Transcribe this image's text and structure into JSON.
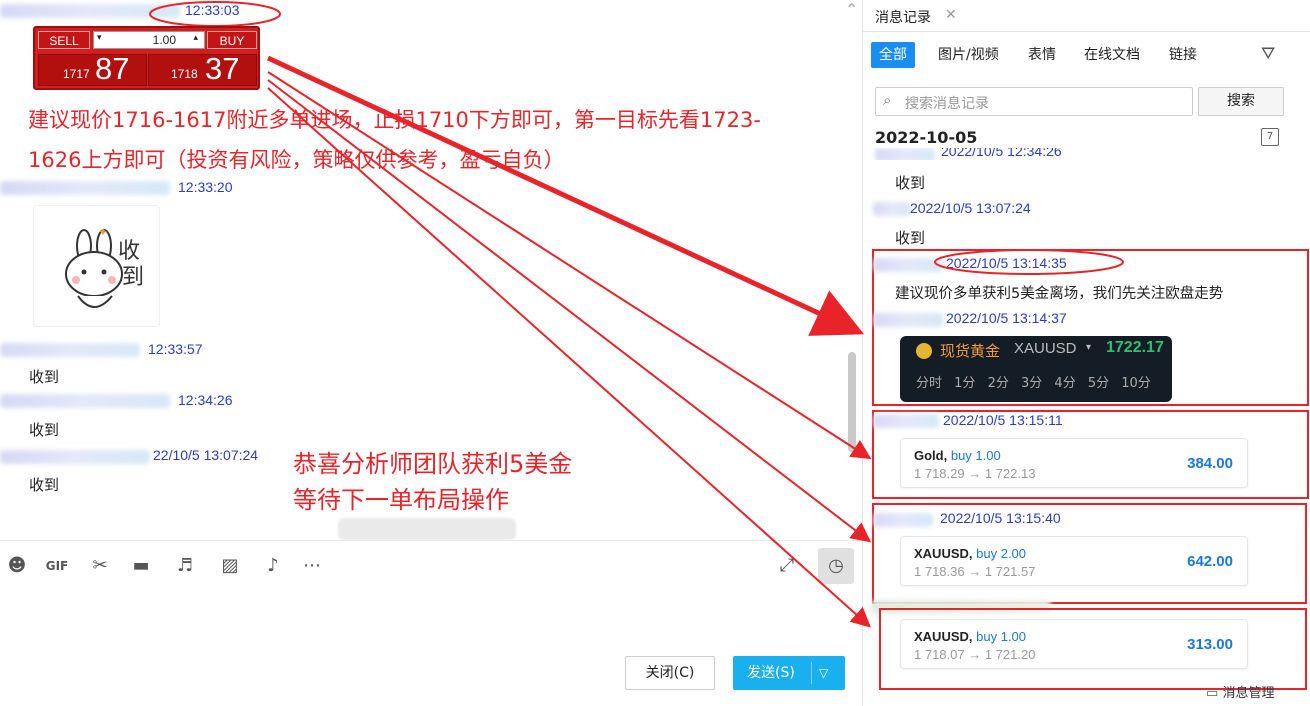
{
  "left": {
    "timestamps": [
      "12:33:03",
      "12:33:20",
      "12:33:57",
      "12:34:26",
      "22/10/5 13:07:24"
    ],
    "trade_widget": {
      "sell": "SELL",
      "buy": "BUY",
      "lot": "1.00",
      "sell_small": "1717",
      "sell_big": "87",
      "buy_small": "1718",
      "buy_big": "37"
    },
    "annotation_1": "建议现价1716-1617附近多单进场，止损1710下方即可，第一目标先看1723-",
    "annotation_2": "1626上方即可（投资有风险，策略仅供参考，盈亏自负）",
    "sticker_text": "收\n到",
    "received": "收到",
    "annotation_3": "恭喜分析师团队获利5美金",
    "annotation_4": "等待下一单布局操作",
    "close_button": "关闭(C)",
    "send_button": "发送(S)"
  },
  "right": {
    "tab_title": "消息记录",
    "filters": [
      "全部",
      "图片/视频",
      "表情",
      "在线文档",
      "链接"
    ],
    "search_placeholder": "搜索消息记录",
    "search_button": "搜索",
    "date": "2022-10-05",
    "entries": [
      {
        "time": "2022/10/5 12:34:26",
        "text": "收到"
      },
      {
        "time": "2022/10/5 13:07:24",
        "text": "收到"
      },
      {
        "time": "2022/10/5 13:14:35",
        "text": "建议现价多单获利5美金离场，我们先关注欧盘走势"
      },
      {
        "time": "2022/10/5 13:14:37"
      },
      {
        "time": "2022/10/5 13:15:11"
      },
      {
        "time": "2022/10/5 13:15:40"
      }
    ],
    "quote_card": {
      "name": "现货黄金",
      "symbol": "XAUUSD",
      "price": "1722.17",
      "intervals": [
        "分时",
        "1分",
        "2分",
        "3分",
        "4分",
        "5分",
        "10分"
      ]
    },
    "trades": [
      {
        "symbol": "Gold,",
        "side": "buy 1.00",
        "route": "1 718.29 → 1 722.13",
        "pl": "384.00"
      },
      {
        "symbol": "XAUUSD,",
        "side": "buy 2.00",
        "route": "1 718.36 → 1 721.57",
        "pl": "642.00"
      },
      {
        "symbol": "XAUUSD,",
        "side": "buy 1.00",
        "route": "1 718.07 → 1 721.20",
        "pl": "313.00"
      }
    ],
    "footer_link": "消息管理"
  },
  "colors": {
    "annotation": "#e8242a",
    "timestamp": "#2a3cc6",
    "accent": "#1a8ef0",
    "send": "#1ab0ef"
  }
}
